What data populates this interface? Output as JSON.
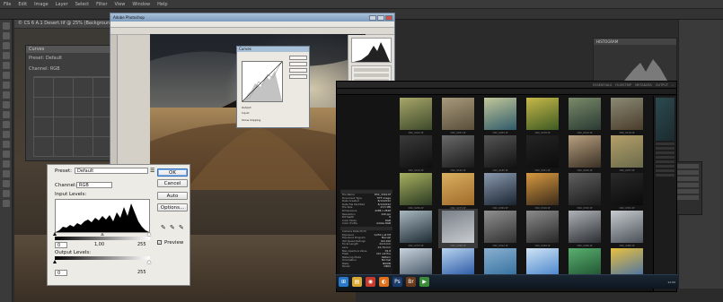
{
  "ps_cs6": {
    "menu": [
      "File",
      "Edit",
      "Image",
      "Layer",
      "Select",
      "Filter",
      "View",
      "Window",
      "Help"
    ],
    "doc_tab": "© CS 6 A.1 Desert.tif @ 25% (Background, RGB/8)",
    "curves_title": "Curves",
    "preset_label": "Preset:",
    "preset_value": "Default",
    "channel_label": "Channel:",
    "channel_value": "RGB",
    "histogram_title": "HISTOGRAM"
  },
  "ps_cs5": {
    "title": "Adobe Photoshop",
    "curves_title": "Curves",
    "buttons": [
      "OK",
      "Cancel",
      "Auto",
      "Options..."
    ],
    "output_label": "Output:",
    "input_label": "Input:",
    "show_clipping": "Show Clipping",
    "preview": "Preview"
  },
  "levels": {
    "preset_label": "Preset:",
    "preset_value": "Default",
    "channel_label": "Channel:",
    "channel_value": "RGB",
    "input_label": "Input Levels:",
    "input_black": "0",
    "input_mid": "1,00",
    "input_white": "255",
    "output_label": "Output Levels:",
    "output_black": "0",
    "output_white": "255",
    "ok": "OK",
    "cancel": "Cancel",
    "auto": "Auto",
    "options": "Options...",
    "preview": "Preview",
    "preview_checked": true
  },
  "bridge": {
    "workspaces": [
      "ESSENTIALS",
      "FILMSTRIP",
      "METADATA",
      "OUTPUT"
    ],
    "search_placeholder": "",
    "metadata": [
      [
        "File Name",
        "DSC_4310.tif"
      ],
      [
        "Document Type",
        "TIFF image"
      ],
      [
        "Date Created",
        "8/14/2012"
      ],
      [
        "Date File Modified",
        "8/14/2012"
      ],
      [
        "File Size",
        "23.5 MB"
      ],
      [
        "Dimensions",
        "4288 x 2848"
      ],
      [
        "Resolution",
        "240 ppi"
      ],
      [
        "Bit Depth",
        "8"
      ],
      [
        "Color Mode",
        "RGB"
      ],
      [
        "Color Profile",
        "Adobe RGB"
      ],
      [
        "Camera Data (Exif)",
        ""
      ],
      [
        "Exposure",
        "1/250 s at f/8"
      ],
      [
        "Exposure Program",
        "Manual"
      ],
      [
        "ISO Speed Ratings",
        "ISO 200"
      ],
      [
        "Focal Length",
        "24.0 mm"
      ],
      [
        "Lens",
        "24-70 mm"
      ],
      [
        "Max Aperture Value",
        "f/2.8"
      ],
      [
        "Flash",
        "Did not fire"
      ],
      [
        "Metering Mode",
        "Pattern"
      ],
      [
        "Orientation",
        "Normal"
      ],
      [
        "Make",
        "NIKON"
      ],
      [
        "Model",
        "D800"
      ]
    ],
    "thumbnails": [
      {
        "caption": "DSC_0012.tif",
        "c1": "#3d4a2a",
        "c2": "#a8a66a"
      },
      {
        "caption": "DSC_0031.tif",
        "c1": "#5a4e3c",
        "c2": "#a89a7a"
      },
      {
        "caption": "DSC_0055.tif",
        "c1": "#2e5a6a",
        "c2": "#c4c89a"
      },
      {
        "caption": "DSC_0078.tif",
        "c1": "#3c5a22",
        "c2": "#c8b84a"
      },
      {
        "caption": "DSC_0102.tif",
        "c1": "#2a3a32",
        "c2": "#7a8a6a"
      },
      {
        "caption": "DSC_0118.tif",
        "c1": "#4a3c2a",
        "c2": "#8a8a74"
      },
      {
        "caption": "DSC_0144.tif",
        "c1": "#0e0e0e",
        "c2": "#3a3a3a"
      },
      {
        "caption": "DSC_0160.tif",
        "c1": "#1a1a1a",
        "c2": "#6a6a6a"
      },
      {
        "caption": "DSC_0185.tif",
        "c1": "#111111",
        "c2": "#555555"
      },
      {
        "caption": "DSC_0201.tif",
        "c1": "#0c0c0c",
        "c2": "#242424"
      },
      {
        "caption": "DSC_0220.tif",
        "c1": "#3a3024",
        "c2": "#b8a080"
      },
      {
        "caption": "DSC_0237.tif",
        "c1": "#6a6a4a",
        "c2": "#b4a06a"
      },
      {
        "caption": "DSC_0259.tif",
        "c1": "#2a3a22",
        "c2": "#a8b060"
      },
      {
        "caption": "DSC_0273.tif",
        "c1": "#a06a2a",
        "c2": "#d8b060"
      },
      {
        "caption": "DSC_0294.tif",
        "c1": "#1a2430",
        "c2": "#8a9ab0"
      },
      {
        "caption": "DSC_0310.tif",
        "c1": "#3a2a1a",
        "c2": "#d89a40"
      },
      {
        "caption": "DSC_0332.tif",
        "c1": "#1a1a1a",
        "c2": "#606060"
      },
      {
        "caption": "DSC_0351.tif",
        "c1": "#0a0a0a",
        "c2": "#2a2a2a"
      },
      {
        "caption": "DSC_0373.tif",
        "c1": "#1c2a34",
        "c2": "#aab8c0"
      },
      {
        "caption": "DSC_0390.tif",
        "c1": "#c8ccd0",
        "c2": "#7a8088"
      },
      {
        "caption": "DSC_0412.tif",
        "c1": "#303030",
        "c2": "#909090"
      },
      {
        "caption": "DSC_0428.tif",
        "c1": "#262626",
        "c2": "#8c8c8c"
      },
      {
        "caption": "DSC_0446.tif",
        "c1": "#2a2e32",
        "c2": "#b0b4b8"
      },
      {
        "caption": "DSC_0465.tif",
        "c1": "#4a5058",
        "c2": "#c8ccd0"
      },
      {
        "caption": "DSC_0481.tif",
        "c1": "#3a4a5a",
        "c2": "#c8d4de"
      },
      {
        "caption": "DSC_0503.tif",
        "c1": "#1a4a9a",
        "c2": "#b8d4f0"
      },
      {
        "caption": "DSC_0522.tif",
        "c1": "#2a6a9a",
        "c2": "#8ab0d0"
      },
      {
        "caption": "DSC_0544.tif",
        "c1": "#3a7ac8",
        "c2": "#d0e4f4"
      },
      {
        "caption": "DSC_0560.tif",
        "c1": "#1a4a2a",
        "c2": "#5ab070"
      },
      {
        "caption": "DSC_0583.tif",
        "c1": "#3a6ab0",
        "c2": "#e8c040"
      }
    ]
  },
  "taskbar": {
    "apps": [
      {
        "icon": "windows-orb-icon",
        "color": "#2a78c8",
        "glyph": "⊞"
      },
      {
        "icon": "folder-icon",
        "color": "#d8a830",
        "glyph": "▤"
      },
      {
        "icon": "chrome-icon",
        "color": "#c83a2a",
        "glyph": "◉"
      },
      {
        "icon": "firefox-icon",
        "color": "#e0701a",
        "glyph": "◐"
      },
      {
        "icon": "photoshop-icon",
        "color": "#1a3a6a",
        "glyph": "Ps"
      },
      {
        "icon": "bridge-icon",
        "color": "#6a3a1a",
        "glyph": "Br"
      },
      {
        "icon": "media-icon",
        "color": "#3a8a3a",
        "glyph": "▶"
      }
    ],
    "clock": "12:00"
  }
}
